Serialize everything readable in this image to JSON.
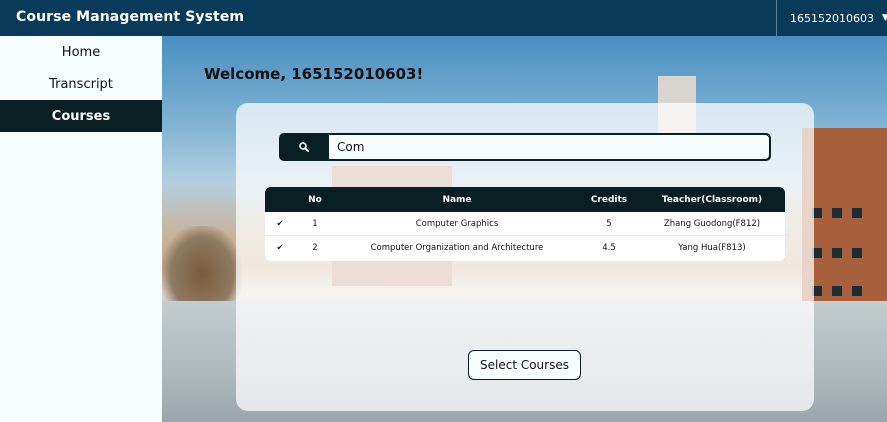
{
  "header": {
    "title": "Course Management System",
    "user": {
      "name": "165152010603",
      "icon": "user-icon",
      "caret": "▼"
    }
  },
  "sidebar": {
    "items": [
      {
        "label": "Home",
        "active": false
      },
      {
        "label": "Transcript",
        "active": false
      },
      {
        "label": "Courses",
        "active": true
      }
    ]
  },
  "main": {
    "welcome": "Welcome, 165152010603!",
    "search": {
      "value": "Com",
      "icon": "search-icon"
    },
    "table": {
      "columns": [
        "",
        "No",
        "Name",
        "Credits",
        "Teacher(Classroom)"
      ],
      "rows": [
        {
          "check": "✔",
          "no": "1",
          "name": "Computer Graphics",
          "credits": "5",
          "teacher": "Zhang Guodong(F812)"
        },
        {
          "check": "✔",
          "no": "2",
          "name": "Computer Organization and Architecture",
          "credits": "4.5",
          "teacher": "Yang Hua(F813)"
        }
      ]
    },
    "select_button": "Select Courses"
  },
  "colors": {
    "header_bg": "#0a3a5a",
    "dark": "#0a1f24",
    "sidebar_bg": "#f6feff"
  }
}
